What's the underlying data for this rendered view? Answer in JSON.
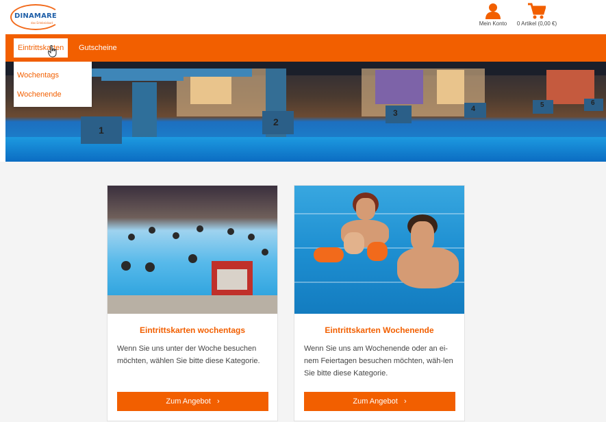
{
  "brand": {
    "logo_text": "DINAMARE",
    "logo_sub": "das Erlebnisbad"
  },
  "header": {
    "account_label": "Mein Konto",
    "cart_label": "0 Artikel (0,00 €)"
  },
  "nav": {
    "items": [
      {
        "label": "Eintrittskarten"
      },
      {
        "label": "Gutscheine"
      }
    ],
    "dropdown": [
      {
        "label": "Wochentags"
      },
      {
        "label": "Wochenende"
      }
    ]
  },
  "cards": [
    {
      "title": "Eintrittskarten wochentags",
      "description": "Wenn Sie uns unter der Woche besuchen möchten, wählen Sie bitte diese Kategorie.",
      "button": "Zum Angebot"
    },
    {
      "title": "Eintrittskarten Wochenende",
      "description": "Wenn Sie uns am Wochenende oder an ei-nem Feiertagen besuchen möchten, wäh-len Sie bitte diese Kategorie.",
      "button": "Zum Angebot"
    }
  ],
  "hero": {
    "lane_numbers": [
      "1",
      "2",
      "3",
      "4",
      "5",
      "6"
    ]
  },
  "colors": {
    "accent": "#f25f00",
    "logo_blue": "#1f5fa8"
  },
  "icons": {
    "account": "user-icon",
    "cart": "cart-icon",
    "button_arrow": "chevron-right-icon"
  }
}
